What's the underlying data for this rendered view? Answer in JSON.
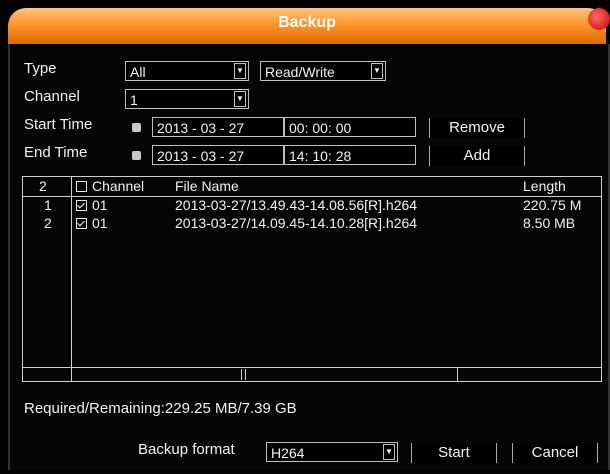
{
  "window": {
    "title": "Backup"
  },
  "form": {
    "type_label": "Type",
    "type_value": "All",
    "mode_value": "Read/Write",
    "channel_label": "Channel",
    "channel_value": "1",
    "start_label": "Start Time",
    "start_date": "2013 - 03 - 27",
    "start_time": "00: 00: 00",
    "end_label": "End Time",
    "end_date": "2013 - 03 - 27",
    "end_time": "14: 10: 28",
    "remove_label": "Remove",
    "add_label": "Add"
  },
  "table": {
    "count": "2",
    "headers": {
      "channel": "Channel",
      "file_name": "File Name",
      "length": "Length"
    },
    "rows": [
      {
        "index": "1",
        "checked": true,
        "channel": "01",
        "file_name": "2013-03-27/13.49.43-14.08.56[R].h264",
        "length": "220.75 M"
      },
      {
        "index": "2",
        "checked": true,
        "channel": "01",
        "file_name": "2013-03-27/14.09.45-14.10.28[R].h264",
        "length": "8.50 MB"
      }
    ]
  },
  "status": {
    "required_remaining": "Required/Remaining:229.25 MB/7.39 GB"
  },
  "footer": {
    "format_label": "Backup format",
    "format_value": "H264",
    "start_label": "Start",
    "cancel_label": "Cancel"
  },
  "colors": {
    "title_orange": "#ff9a33",
    "background": "#000000",
    "text": "#f2f2f2"
  }
}
